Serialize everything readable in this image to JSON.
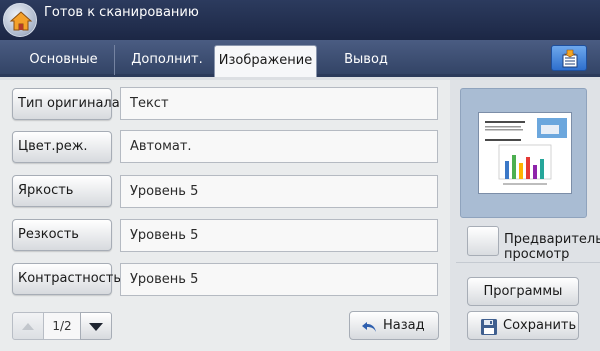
{
  "header": {
    "title": "Готов к сканированию"
  },
  "tabs": [
    {
      "label": "Основные",
      "active": false
    },
    {
      "label": "Дополнит.",
      "active": false
    },
    {
      "label": "Изображение",
      "active": true
    },
    {
      "label": "Вывод",
      "active": false
    }
  ],
  "settings": [
    {
      "label": "Тип оригинала",
      "value": "Текст"
    },
    {
      "label": "Цвет.реж.",
      "value": "Автомат."
    },
    {
      "label": "Яркость",
      "value": "Уровень 5"
    },
    {
      "label": "Резкость",
      "value": "Уровень 5"
    },
    {
      "label": "Контрастность",
      "value": "Уровень 5"
    }
  ],
  "pagination": {
    "page": "1/2"
  },
  "buttons": {
    "back": "Назад",
    "programs": "Программы",
    "save": "Сохранить"
  },
  "preview": {
    "label_line1": "Предварительный",
    "label_line2": "просмотр"
  },
  "icons": {
    "home": "home-icon",
    "tab_tool": "document-list-icon",
    "back": "undo-arrow-icon",
    "save": "floppy-disk-icon"
  },
  "colors": {
    "header_bg": "#1c2745",
    "tab_bg": "#3f5076",
    "accent_blue": "#2e6fcd"
  }
}
